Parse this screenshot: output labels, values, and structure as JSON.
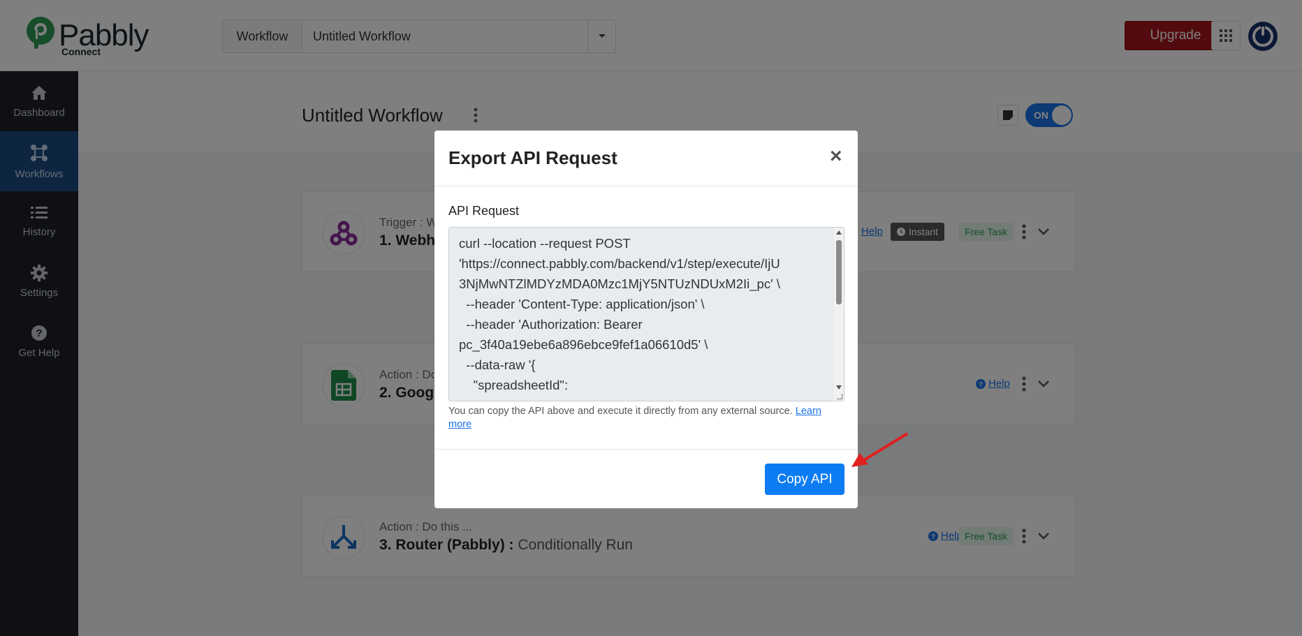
{
  "header": {
    "logo_text": "Pabbly",
    "logo_sub": "Connect",
    "workflow_label": "Workflow",
    "workflow_value": "Untitled Workflow",
    "upgrade_label": "Upgrade"
  },
  "sidebar": {
    "items": [
      {
        "label": "Dashboard",
        "icon": "home-icon"
      },
      {
        "label": "Workflows",
        "icon": "workflows-icon"
      },
      {
        "label": "History",
        "icon": "history-icon"
      },
      {
        "label": "Settings",
        "icon": "gear-icon"
      },
      {
        "label": "Get Help",
        "icon": "help-icon"
      }
    ]
  },
  "main": {
    "title": "Untitled Workflow",
    "toggle_label": "ON",
    "steps": [
      {
        "sub": "Trigger : W",
        "name": "1. Webh",
        "help": "Help",
        "instant": "Instant",
        "free": "Free Task"
      },
      {
        "sub": "Action : Do",
        "name": "2. Goog",
        "help": "Help"
      },
      {
        "sub": "Action : Do this ...",
        "name": "3. Router (Pabbly) :",
        "name_light": "Conditionally Run",
        "help": "Help",
        "free": "Free Task"
      }
    ]
  },
  "modal": {
    "title": "Export API Request",
    "close": "×",
    "api_label": "API Request",
    "api_text": "curl --location --request POST\n'https://connect.pabbly.com/backend/v1/step/execute/IjU\n3NjMwNTZlMDYzMDA0Mzc1MjY5NTUzNDUxM2Ii_pc' \\\n  --header 'Content-Type: application/json' \\\n  --header 'Authorization: Bearer\npc_3f40a19ebe6a896ebce9fef1a06610d5' \\\n  --data-raw '{\n    \"spreadsheetId\":",
    "note": "You can copy the API above and execute it directly from any external source.",
    "learn_more": "Learn more",
    "copy_label": "Copy API"
  }
}
